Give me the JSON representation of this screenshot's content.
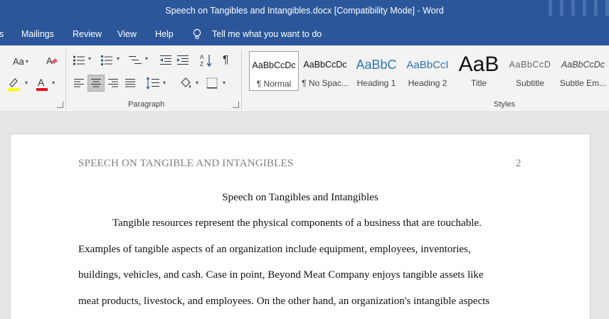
{
  "app": {
    "window_title": "Speech on Tangibles and Intangibles.docx [Compatibility Mode]  -  Word"
  },
  "menu": {
    "items": [
      "s",
      "Mailings",
      "Review",
      "View",
      "Help"
    ],
    "tell_me": "Tell me what you want to do"
  },
  "ribbon": {
    "font_case_label": "Aa",
    "paragraph_label": "Paragraph",
    "styles_label": "Styles",
    "styles": [
      {
        "preview": "AaBbCcDc",
        "label": "¶ Normal"
      },
      {
        "preview": "AaBbCcDc",
        "label": "¶ No Spac..."
      },
      {
        "preview": "AaBbC",
        "label": "Heading 1"
      },
      {
        "preview": "AaBbCcI",
        "label": "Heading 2"
      },
      {
        "preview": "AaB",
        "label": "Title"
      },
      {
        "preview": "AaBbCcD",
        "label": "Subtitle"
      },
      {
        "preview": "AaBbCcDc",
        "label": "Subtle Em..."
      }
    ],
    "colors": {
      "highlight": "#ffff00",
      "font_color": "#e81123",
      "accent": "#2b579a"
    }
  },
  "document": {
    "running_header": "SPEECH ON TANGIBLE AND INTANGIBLES",
    "page_number": "2",
    "title": "Speech on Tangibles and Intangibles",
    "lines": [
      "Tangible resources represent the physical components of a business that are touchable.",
      "Examples of tangible aspects of an organization include equipment, employees, inventories,",
      "buildings, vehicles, and cash. Case in point, Beyond Meat Company enjoys tangible assets like",
      "meat products, livestock, and employees.  On the other hand, an organization's intangible aspects"
    ]
  }
}
